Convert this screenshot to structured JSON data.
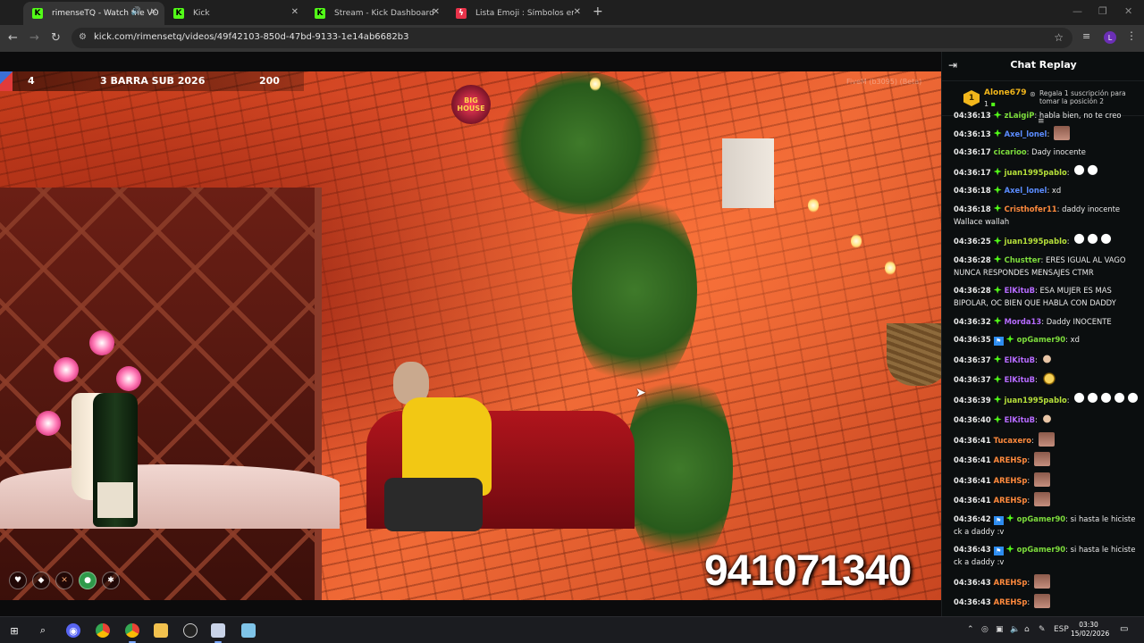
{
  "browser": {
    "tabs": [
      {
        "title": "rimenseTQ - Watch the VO",
        "icon": "kick-favicon",
        "active": true,
        "audio": true
      },
      {
        "title": "Kick",
        "icon": "kick-favicon",
        "active": false
      },
      {
        "title": "Stream - Kick Dashboard",
        "icon": "kick-favicon",
        "active": false
      },
      {
        "title": "Lista Emoji : Símbolos emoji no",
        "icon": "emoji-favicon",
        "active": false
      }
    ],
    "url": "kick.com/rimensetq/videos/49f42103-850d-47bd-9133-1e14ab6682b3",
    "profile_initial": "L"
  },
  "video": {
    "hud": {
      "left_value": "4",
      "center_text": "3 BARRA SUB 2026",
      "right_value": "200"
    },
    "logo_text": "BIG HOUSE",
    "watermark": "FiveM (b3095) (Beta)",
    "overlay_number": "941071340",
    "hud_icons": [
      "heart-icon",
      "shield-icon",
      "food-icon",
      "water-icon",
      "star-icon"
    ]
  },
  "chat": {
    "title": "Chat Replay",
    "pinned": {
      "rank": "1",
      "user": "Alone679",
      "count": "1",
      "gift_text": "Regala 1 suscripción para tomar la posición 2"
    },
    "top_partial": {
      "time": "04:36:13",
      "user": "zLaigiP",
      "text": "habla bien, no te creo"
    },
    "messages": [
      {
        "time": "04:36:13",
        "user": "Axel_lonel",
        "color": "#5b8cff",
        "text": "",
        "emotes": [
          "face"
        ],
        "badges": [
          "sub"
        ]
      },
      {
        "time": "04:36:17",
        "user": "cicarioo",
        "color": "#7ddc3c",
        "text": "Dady inocente",
        "emotes": [],
        "badges": []
      },
      {
        "time": "04:36:17",
        "user": "juan1995pablo",
        "color": "#b6e03a",
        "text": "",
        "emotes": [
          "duck",
          "duck"
        ],
        "badges": [
          "sub"
        ]
      },
      {
        "time": "04:36:18",
        "user": "Axel_lonel",
        "color": "#5b8cff",
        "text": "xd",
        "emotes": [],
        "badges": [
          "sub"
        ]
      },
      {
        "time": "04:36:18",
        "user": "Cristhofer11",
        "color": "#ff8a3d",
        "text": "daddy inocente Wallace wallah",
        "emotes": [],
        "badges": [
          "sub"
        ]
      },
      {
        "time": "04:36:25",
        "user": "juan1995pablo",
        "color": "#b6e03a",
        "text": "",
        "emotes": [
          "duck",
          "duck",
          "duck"
        ],
        "badges": [
          "sub"
        ]
      },
      {
        "time": "04:36:28",
        "user": "Chustter",
        "color": "#7ddc3c",
        "text": "ERES IGUAL AL VAGO NUNCA RESPONDES MENSAJES CTMR",
        "emotes": [],
        "badges": [
          "sub"
        ]
      },
      {
        "time": "04:36:28",
        "user": "ElKituB",
        "color": "#b66bff",
        "text": "ESA MUJER ES MAS BIPOLAR, OC BIEN QUE HABLA CON DADDY",
        "emotes": [],
        "badges": [
          "sub"
        ]
      },
      {
        "time": "04:36:32",
        "user": "Morda13",
        "color": "#b66bff",
        "text": "Daddy INOCENTE",
        "emotes": [],
        "badges": [
          "sub"
        ]
      },
      {
        "time": "04:36:35",
        "user": "opGamer90",
        "color": "#7ddc3c",
        "text": "xd",
        "emotes": [],
        "badges": [
          "vip",
          "sub"
        ]
      },
      {
        "time": "04:36:37",
        "user": "ElKituB",
        "color": "#b66bff",
        "text": "",
        "emotes": [
          "bird"
        ],
        "badges": [
          "sub"
        ]
      },
      {
        "time": "04:36:37",
        "user": "ElKituB",
        "color": "#b66bff",
        "text": "",
        "emotes": [
          "gold"
        ],
        "badges": [
          "sub"
        ]
      },
      {
        "time": "04:36:39",
        "user": "juan1995pablo",
        "color": "#b6e03a",
        "text": "",
        "emotes": [
          "duck",
          "duck",
          "duck",
          "duck",
          "duck"
        ],
        "badges": [
          "sub"
        ]
      },
      {
        "time": "04:36:40",
        "user": "ElKituB",
        "color": "#b66bff",
        "text": "",
        "emotes": [
          "bird"
        ],
        "badges": [
          "sub"
        ]
      },
      {
        "time": "04:36:41",
        "user": "Tucaxero",
        "color": "#ff8a3d",
        "text": "",
        "emotes": [
          "face"
        ],
        "badges": []
      },
      {
        "time": "04:36:41",
        "user": "AREHSp",
        "color": "#ff8a3d",
        "text": "",
        "emotes": [
          "face"
        ],
        "badges": []
      },
      {
        "time": "04:36:41",
        "user": "AREHSp",
        "color": "#ff8a3d",
        "text": "",
        "emotes": [
          "face"
        ],
        "badges": []
      },
      {
        "time": "04:36:41",
        "user": "AREHSp",
        "color": "#ff8a3d",
        "text": "",
        "emotes": [
          "face"
        ],
        "badges": []
      },
      {
        "time": "04:36:42",
        "user": "opGamer90",
        "color": "#7ddc3c",
        "text": "si hasta le hiciste ck a daddy :v",
        "emotes": [],
        "badges": [
          "vip",
          "sub"
        ]
      },
      {
        "time": "04:36:43",
        "user": "opGamer90",
        "color": "#7ddc3c",
        "text": "si hasta le hiciste ck a daddy :v",
        "emotes": [],
        "badges": [
          "vip",
          "sub"
        ]
      },
      {
        "time": "04:36:43",
        "user": "AREHSp",
        "color": "#ff8a3d",
        "text": "",
        "emotes": [
          "face"
        ],
        "badges": []
      },
      {
        "time": "04:36:43",
        "user": "AREHSp",
        "color": "#ff8a3d",
        "text": "",
        "emotes": [
          "face"
        ],
        "badges": []
      }
    ]
  },
  "taskbar": {
    "language": "ESP",
    "time": "03:30",
    "date": "15/02/2026",
    "apps": [
      "windows-start-icon",
      "search-icon",
      "discord-icon",
      "chrome-icon",
      "chrome-profile-icon",
      "file-explorer-icon",
      "obs-icon",
      "fivem-icon",
      "notepad-icon"
    ]
  }
}
